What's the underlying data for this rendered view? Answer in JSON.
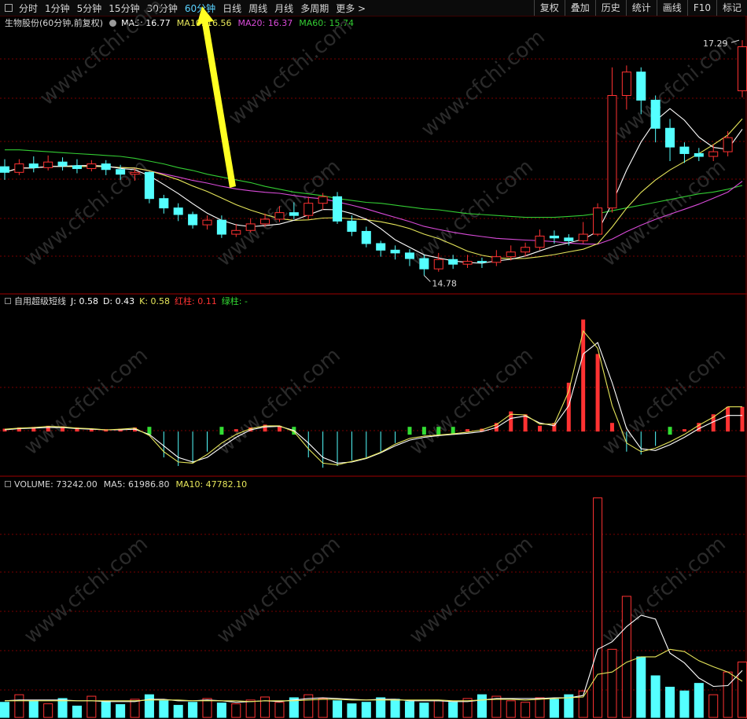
{
  "toolbar": {
    "tabs": [
      "分时",
      "1分钟",
      "5分钟",
      "15分钟",
      "30分钟",
      "60分钟",
      "日线",
      "周线",
      "月线",
      "多周期",
      "更多 >"
    ],
    "active_tab": "60分钟",
    "right_buttons": [
      "复权",
      "叠加",
      "历史",
      "统计",
      "画线",
      "F10",
      "标记"
    ]
  },
  "price_panel": {
    "title": "生物股份(60分钟,前复权)",
    "ma5": "MA5: 16.77",
    "ma10": "MA10: 16.56",
    "ma20": "MA20: 16.37",
    "ma60": "MA60: 15.74",
    "high_label": "17.29",
    "low_label": "14.78"
  },
  "kdj_panel": {
    "title": "自用超级短线",
    "j": "J: 0.58",
    "d": "D: 0.43",
    "k": "K: 0.58",
    "red": "红柱: 0.11",
    "green": "绿柱: -"
  },
  "volume_panel": {
    "volume": "VOLUME: 73242.00",
    "ma5": "MA5: 61986.80",
    "ma10": "MA10: 47782.10"
  },
  "watermark": "www.cfchi.com",
  "colors": {
    "up": "#ff3232",
    "down": "#54ffff",
    "ma5": "#ffffff",
    "ma10": "#e6e65a",
    "ma20": "#d94bd9",
    "ma60": "#33cc33",
    "kdj_green": "#33dd33",
    "grid": "#780000",
    "arrow": "#ffff22"
  },
  "chart_data": [
    {
      "type": "candlestick",
      "title": "生物股份(60分钟,前复权)",
      "ylim": [
        14.6,
        17.4
      ],
      "series": [
        {
          "name": "MA60",
          "values": [
            16.12,
            16.12,
            16.11,
            16.1,
            16.09,
            16.08,
            16.07,
            16.06,
            16.05,
            16.03,
            16.0,
            15.97,
            15.93,
            15.9,
            15.86,
            15.83,
            15.8,
            15.77,
            15.73,
            15.7,
            15.67,
            15.65,
            15.63,
            15.6,
            15.58,
            15.56,
            15.55,
            15.53,
            15.51,
            15.49,
            15.48,
            15.46,
            15.44,
            15.43,
            15.42,
            15.41,
            15.4,
            15.4,
            15.4,
            15.41,
            15.42,
            15.44,
            15.47,
            15.5,
            15.53,
            15.56,
            15.59,
            15.62,
            15.65,
            15.67,
            15.7,
            15.74
          ]
        }
      ],
      "candles": [
        {
          "o": 15.94,
          "c": 15.88,
          "h": 16.02,
          "l": 15.8
        },
        {
          "o": 15.88,
          "c": 15.97,
          "h": 16.02,
          "l": 15.85
        },
        {
          "o": 15.97,
          "c": 15.93,
          "h": 16.05,
          "l": 15.88
        },
        {
          "o": 15.93,
          "c": 15.99,
          "h": 16.06,
          "l": 15.9
        },
        {
          "o": 15.99,
          "c": 15.95,
          "h": 16.04,
          "l": 15.9
        },
        {
          "o": 15.95,
          "c": 15.92,
          "h": 16.02,
          "l": 15.87
        },
        {
          "o": 15.92,
          "c": 15.97,
          "h": 16.01,
          "l": 15.89
        },
        {
          "o": 15.97,
          "c": 15.91,
          "h": 16.01,
          "l": 15.85
        },
        {
          "o": 15.91,
          "c": 15.86,
          "h": 15.96,
          "l": 15.8
        },
        {
          "o": 15.86,
          "c": 15.88,
          "h": 15.92,
          "l": 15.79
        },
        {
          "o": 15.88,
          "c": 15.6,
          "h": 15.89,
          "l": 15.55
        },
        {
          "o": 15.6,
          "c": 15.5,
          "h": 15.64,
          "l": 15.44
        },
        {
          "o": 15.5,
          "c": 15.43,
          "h": 15.55,
          "l": 15.36
        },
        {
          "o": 15.43,
          "c": 15.32,
          "h": 15.46,
          "l": 15.28
        },
        {
          "o": 15.32,
          "c": 15.37,
          "h": 15.42,
          "l": 15.27
        },
        {
          "o": 15.37,
          "c": 15.22,
          "h": 15.42,
          "l": 15.18
        },
        {
          "o": 15.22,
          "c": 15.26,
          "h": 15.33,
          "l": 15.19
        },
        {
          "o": 15.26,
          "c": 15.33,
          "h": 15.39,
          "l": 15.24
        },
        {
          "o": 15.33,
          "c": 15.38,
          "h": 15.44,
          "l": 15.3
        },
        {
          "o": 15.38,
          "c": 15.45,
          "h": 15.52,
          "l": 15.35
        },
        {
          "o": 15.45,
          "c": 15.42,
          "h": 15.56,
          "l": 15.38
        },
        {
          "o": 15.42,
          "c": 15.55,
          "h": 15.62,
          "l": 15.38
        },
        {
          "o": 15.55,
          "c": 15.62,
          "h": 15.66,
          "l": 15.48
        },
        {
          "o": 15.62,
          "c": 15.36,
          "h": 15.67,
          "l": 15.33
        },
        {
          "o": 15.36,
          "c": 15.25,
          "h": 15.42,
          "l": 15.2
        },
        {
          "o": 15.25,
          "c": 15.12,
          "h": 15.3,
          "l": 15.08
        },
        {
          "o": 15.12,
          "c": 15.05,
          "h": 15.15,
          "l": 14.98
        },
        {
          "o": 15.05,
          "c": 15.02,
          "h": 15.1,
          "l": 14.95
        },
        {
          "o": 15.02,
          "c": 14.96,
          "h": 15.06,
          "l": 14.88
        },
        {
          "o": 14.96,
          "c": 14.85,
          "h": 15.0,
          "l": 14.78
        },
        {
          "o": 14.85,
          "c": 14.95,
          "h": 15.02,
          "l": 14.82
        },
        {
          "o": 14.95,
          "c": 14.9,
          "h": 15.0,
          "l": 14.85
        },
        {
          "o": 14.9,
          "c": 14.93,
          "h": 15.0,
          "l": 14.86
        },
        {
          "o": 14.93,
          "c": 14.92,
          "h": 14.97,
          "l": 14.86
        },
        {
          "o": 14.92,
          "c": 14.98,
          "h": 15.05,
          "l": 14.88
        },
        {
          "o": 14.98,
          "c": 15.03,
          "h": 15.1,
          "l": 14.94
        },
        {
          "o": 15.03,
          "c": 15.08,
          "h": 15.13,
          "l": 14.98
        },
        {
          "o": 15.08,
          "c": 15.2,
          "h": 15.27,
          "l": 15.05
        },
        {
          "o": 15.2,
          "c": 15.18,
          "h": 15.26,
          "l": 15.12
        },
        {
          "o": 15.18,
          "c": 15.15,
          "h": 15.22,
          "l": 15.1
        },
        {
          "o": 15.15,
          "c": 15.22,
          "h": 15.35,
          "l": 15.12
        },
        {
          "o": 15.22,
          "c": 15.5,
          "h": 15.55,
          "l": 15.2
        },
        {
          "o": 15.5,
          "c": 16.7,
          "h": 17.0,
          "l": 15.45
        },
        {
          "o": 16.7,
          "c": 16.95,
          "h": 17.02,
          "l": 16.55
        },
        {
          "o": 16.95,
          "c": 16.65,
          "h": 17.0,
          "l": 16.5
        },
        {
          "o": 16.65,
          "c": 16.35,
          "h": 16.7,
          "l": 16.2
        },
        {
          "o": 16.35,
          "c": 16.15,
          "h": 16.45,
          "l": 16.0
        },
        {
          "o": 16.15,
          "c": 16.08,
          "h": 16.2,
          "l": 15.98
        },
        {
          "o": 16.08,
          "c": 16.05,
          "h": 16.14,
          "l": 16.0
        },
        {
          "o": 16.05,
          "c": 16.1,
          "h": 16.18,
          "l": 16.0
        },
        {
          "o": 16.1,
          "c": 16.25,
          "h": 16.32,
          "l": 16.05
        },
        {
          "o": 16.75,
          "c": 17.22,
          "h": 17.29,
          "l": 16.68
        }
      ]
    },
    {
      "type": "line",
      "title": "自用超级短线",
      "series": [
        {
          "name": "J",
          "values": [
            0.2,
            0.22,
            0.23,
            0.25,
            0.24,
            0.22,
            0.2,
            0.18,
            0.2,
            0.22,
            0.05,
            -0.3,
            -0.45,
            -0.4,
            -0.2,
            0.0,
            0.15,
            0.22,
            0.27,
            0.25,
            0.12,
            -0.3,
            -0.48,
            -0.45,
            -0.35,
            -0.3,
            -0.2,
            -0.05,
            0.05,
            0.08,
            0.1,
            0.12,
            0.15,
            0.2,
            0.3,
            0.5,
            0.45,
            0.25,
            0.3,
            1.0,
            2.1,
            1.5,
            0.3,
            -0.2,
            -0.25,
            -0.1,
            0.0,
            0.15,
            0.3,
            0.45,
            0.58,
            0.58
          ]
        },
        {
          "name": "D",
          "values": [
            0.18,
            0.2,
            0.21,
            0.22,
            0.22,
            0.2,
            0.19,
            0.18,
            0.18,
            0.19,
            0.1,
            -0.1,
            -0.3,
            -0.38,
            -0.3,
            -0.12,
            0.05,
            0.18,
            0.23,
            0.24,
            0.17,
            -0.05,
            -0.3,
            -0.4,
            -0.38,
            -0.32,
            -0.22,
            -0.1,
            0.0,
            0.05,
            0.08,
            0.1,
            0.12,
            0.15,
            0.22,
            0.38,
            0.42,
            0.3,
            0.25,
            0.6,
            1.5,
            1.7,
            1.0,
            0.2,
            -0.15,
            -0.18,
            -0.08,
            0.05,
            0.2,
            0.32,
            0.43,
            0.43
          ]
        },
        {
          "name": "K",
          "values": [
            0.19,
            0.21,
            0.22,
            0.24,
            0.23,
            0.21,
            0.2,
            0.18,
            0.19,
            0.21,
            0.08,
            -0.2,
            -0.38,
            -0.4,
            -0.25,
            -0.05,
            0.1,
            0.2,
            0.25,
            0.25,
            0.15,
            -0.15,
            -0.4,
            -0.43,
            -0.37,
            -0.31,
            -0.21,
            -0.07,
            0.03,
            0.07,
            0.09,
            0.11,
            0.14,
            0.18,
            0.27,
            0.45,
            0.44,
            0.28,
            0.28,
            0.85,
            1.9,
            1.6,
            0.6,
            -0.05,
            -0.2,
            -0.14,
            -0.03,
            0.1,
            0.26,
            0.4,
            0.58,
            0.58
          ]
        }
      ]
    },
    {
      "type": "bar",
      "title": "VOLUME",
      "ylim": [
        0,
        300000
      ],
      "values": [
        20000,
        30000,
        22000,
        18000,
        25000,
        15000,
        28000,
        21000,
        17000,
        24000,
        30000,
        22000,
        16000,
        20000,
        25000,
        19000,
        18000,
        23000,
        27000,
        20000,
        26000,
        30000,
        25000,
        22000,
        18000,
        20000,
        26000,
        24000,
        21000,
        19000,
        22000,
        20000,
        25000,
        30000,
        28000,
        22000,
        20000,
        26000,
        24000,
        30000,
        35000,
        290000,
        90000,
        160000,
        80000,
        55000,
        40000,
        35000,
        45000,
        30000,
        60000,
        73242
      ],
      "series": [
        {
          "name": "MA5",
          "values": [
            22000,
            23000,
            23000,
            23000,
            23000,
            22000,
            22000,
            21000,
            21000,
            21000,
            24000,
            24000,
            22000,
            22000,
            23000,
            22000,
            20000,
            21000,
            22000,
            21000,
            23000,
            25000,
            26000,
            25000,
            24000,
            23000,
            24000,
            24000,
            22000,
            22000,
            22000,
            21000,
            21000,
            23000,
            25000,
            25000,
            25000,
            25000,
            26000,
            26000,
            29000,
            90000,
            100000,
            120000,
            135000,
            130000,
            85000,
            72000,
            52000,
            41000,
            42000,
            61987
          ]
        },
        {
          "name": "MA10",
          "values": [
            22000,
            22000,
            22000,
            22000,
            22000,
            22000,
            22000,
            22000,
            22000,
            22000,
            23000,
            23000,
            23000,
            22000,
            22000,
            22000,
            22000,
            21000,
            22000,
            22000,
            22000,
            23000,
            24000,
            24000,
            23000,
            23000,
            23000,
            23000,
            23000,
            23000,
            23000,
            22000,
            22000,
            23000,
            24000,
            24000,
            23000,
            24000,
            25000,
            26000,
            27000,
            57000,
            60000,
            73000,
            80000,
            80000,
            90000,
            87000,
            75000,
            67000,
            60000,
            47782
          ]
        }
      ]
    }
  ]
}
